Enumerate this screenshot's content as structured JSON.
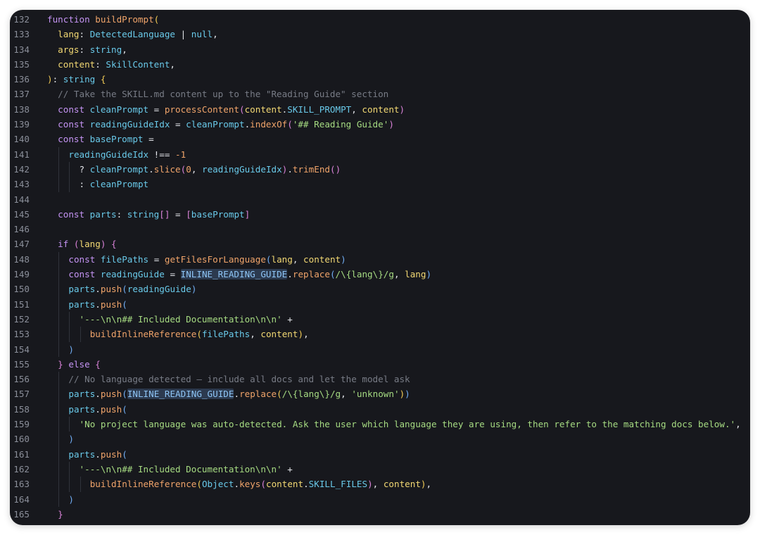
{
  "editor": {
    "lines": [
      {
        "num": "132",
        "indent": 0,
        "tokens": [
          {
            "t": "function ",
            "c": "kw"
          },
          {
            "t": "buildPrompt",
            "c": "fn"
          },
          {
            "t": "(",
            "c": "br1"
          }
        ]
      },
      {
        "num": "133",
        "indent": 1,
        "tokens": [
          {
            "t": "lang",
            "c": "pr"
          },
          {
            "t": ": ",
            "c": "pl"
          },
          {
            "t": "DetectedLanguage",
            "c": "ty"
          },
          {
            "t": " | ",
            "c": "pl"
          },
          {
            "t": "null",
            "c": "ty"
          },
          {
            "t": ",",
            "c": "pl"
          }
        ]
      },
      {
        "num": "134",
        "indent": 1,
        "tokens": [
          {
            "t": "args",
            "c": "pr"
          },
          {
            "t": ": ",
            "c": "pl"
          },
          {
            "t": "string",
            "c": "ty"
          },
          {
            "t": ",",
            "c": "pl"
          }
        ]
      },
      {
        "num": "135",
        "indent": 1,
        "tokens": [
          {
            "t": "content",
            "c": "pr"
          },
          {
            "t": ": ",
            "c": "pl"
          },
          {
            "t": "SkillContent",
            "c": "ty"
          },
          {
            "t": ",",
            "c": "pl"
          }
        ]
      },
      {
        "num": "136",
        "indent": 0,
        "tokens": [
          {
            "t": ")",
            "c": "br1"
          },
          {
            "t": ": ",
            "c": "pl"
          },
          {
            "t": "string",
            "c": "ty"
          },
          {
            "t": " ",
            "c": "pl"
          },
          {
            "t": "{",
            "c": "br1"
          }
        ]
      },
      {
        "num": "137",
        "indent": 1,
        "tokens": [
          {
            "t": "// Take the SKILL.md content up to the \"Reading Guide\" section",
            "c": "cmt"
          }
        ]
      },
      {
        "num": "138",
        "indent": 1,
        "tokens": [
          {
            "t": "const ",
            "c": "kw"
          },
          {
            "t": "cleanPrompt",
            "c": "ty"
          },
          {
            "t": " = ",
            "c": "pl"
          },
          {
            "t": "processContent",
            "c": "fn"
          },
          {
            "t": "(",
            "c": "br2"
          },
          {
            "t": "content",
            "c": "pr"
          },
          {
            "t": ".",
            "c": "pl"
          },
          {
            "t": "SKILL_PROMPT",
            "c": "ty"
          },
          {
            "t": ", ",
            "c": "pl"
          },
          {
            "t": "content",
            "c": "pr"
          },
          {
            "t": ")",
            "c": "br2"
          }
        ]
      },
      {
        "num": "139",
        "indent": 1,
        "tokens": [
          {
            "t": "const ",
            "c": "kw"
          },
          {
            "t": "readingGuideIdx",
            "c": "ty"
          },
          {
            "t": " = ",
            "c": "pl"
          },
          {
            "t": "cleanPrompt",
            "c": "ty"
          },
          {
            "t": ".",
            "c": "pl"
          },
          {
            "t": "indexOf",
            "c": "fn"
          },
          {
            "t": "(",
            "c": "br2"
          },
          {
            "t": "'## Reading Guide'",
            "c": "str"
          },
          {
            "t": ")",
            "c": "br2"
          }
        ]
      },
      {
        "num": "140",
        "indent": 1,
        "tokens": [
          {
            "t": "const ",
            "c": "kw"
          },
          {
            "t": "basePrompt",
            "c": "ty"
          },
          {
            "t": " =",
            "c": "pl"
          }
        ]
      },
      {
        "num": "141",
        "indent": 2,
        "tokens": [
          {
            "t": "readingGuideIdx",
            "c": "ty"
          },
          {
            "t": " !== ",
            "c": "pl"
          },
          {
            "t": "-1",
            "c": "num"
          }
        ]
      },
      {
        "num": "142",
        "indent": 3,
        "tokens": [
          {
            "t": "? ",
            "c": "pl"
          },
          {
            "t": "cleanPrompt",
            "c": "ty"
          },
          {
            "t": ".",
            "c": "pl"
          },
          {
            "t": "slice",
            "c": "fn"
          },
          {
            "t": "(",
            "c": "br2"
          },
          {
            "t": "0",
            "c": "num"
          },
          {
            "t": ", ",
            "c": "pl"
          },
          {
            "t": "readingGuideIdx",
            "c": "ty"
          },
          {
            "t": ")",
            "c": "br2"
          },
          {
            "t": ".",
            "c": "pl"
          },
          {
            "t": "trimEnd",
            "c": "fn"
          },
          {
            "t": "()",
            "c": "br2"
          }
        ]
      },
      {
        "num": "143",
        "indent": 3,
        "tokens": [
          {
            "t": ": ",
            "c": "pl"
          },
          {
            "t": "cleanPrompt",
            "c": "ty"
          }
        ]
      },
      {
        "num": "144",
        "indent": 1,
        "tokens": []
      },
      {
        "num": "145",
        "indent": 1,
        "tokens": [
          {
            "t": "const ",
            "c": "kw"
          },
          {
            "t": "parts",
            "c": "ty"
          },
          {
            "t": ": ",
            "c": "pl"
          },
          {
            "t": "string",
            "c": "ty"
          },
          {
            "t": "[]",
            "c": "br2"
          },
          {
            "t": " = ",
            "c": "pl"
          },
          {
            "t": "[",
            "c": "br2"
          },
          {
            "t": "basePrompt",
            "c": "ty"
          },
          {
            "t": "]",
            "c": "br2"
          }
        ]
      },
      {
        "num": "146",
        "indent": 1,
        "tokens": []
      },
      {
        "num": "147",
        "indent": 1,
        "tokens": [
          {
            "t": "if ",
            "c": "kw"
          },
          {
            "t": "(",
            "c": "br2"
          },
          {
            "t": "lang",
            "c": "pr"
          },
          {
            "t": ")",
            "c": "br2"
          },
          {
            "t": " ",
            "c": "pl"
          },
          {
            "t": "{",
            "c": "br2"
          }
        ]
      },
      {
        "num": "148",
        "indent": 2,
        "tokens": [
          {
            "t": "const ",
            "c": "kw"
          },
          {
            "t": "filePaths",
            "c": "ty"
          },
          {
            "t": " = ",
            "c": "pl"
          },
          {
            "t": "getFilesForLanguage",
            "c": "fn"
          },
          {
            "t": "(",
            "c": "br3"
          },
          {
            "t": "lang",
            "c": "pr"
          },
          {
            "t": ", ",
            "c": "pl"
          },
          {
            "t": "content",
            "c": "pr"
          },
          {
            "t": ")",
            "c": "br3"
          }
        ]
      },
      {
        "num": "149",
        "indent": 2,
        "tokens": [
          {
            "t": "const ",
            "c": "kw"
          },
          {
            "t": "readingGuide",
            "c": "ty"
          },
          {
            "t": " = ",
            "c": "pl"
          },
          {
            "t": "INLINE_READING_GUIDE",
            "c": "hl"
          },
          {
            "t": ".",
            "c": "pl"
          },
          {
            "t": "replace",
            "c": "fn"
          },
          {
            "t": "(",
            "c": "br3"
          },
          {
            "t": "/\\{lang\\}/g",
            "c": "str"
          },
          {
            "t": ", ",
            "c": "pl"
          },
          {
            "t": "lang",
            "c": "pr"
          },
          {
            "t": ")",
            "c": "br3"
          }
        ]
      },
      {
        "num": "150",
        "indent": 2,
        "tokens": [
          {
            "t": "parts",
            "c": "ty"
          },
          {
            "t": ".",
            "c": "pl"
          },
          {
            "t": "push",
            "c": "fn"
          },
          {
            "t": "(",
            "c": "br3"
          },
          {
            "t": "readingGuide",
            "c": "ty"
          },
          {
            "t": ")",
            "c": "br3"
          }
        ]
      },
      {
        "num": "151",
        "indent": 2,
        "tokens": [
          {
            "t": "parts",
            "c": "ty"
          },
          {
            "t": ".",
            "c": "pl"
          },
          {
            "t": "push",
            "c": "fn"
          },
          {
            "t": "(",
            "c": "br3"
          }
        ]
      },
      {
        "num": "152",
        "indent": 3,
        "tokens": [
          {
            "t": "'---\\n\\n## Included Documentation\\n\\n'",
            "c": "str"
          },
          {
            "t": " +",
            "c": "pl"
          }
        ]
      },
      {
        "num": "153",
        "indent": 4,
        "tokens": [
          {
            "t": "buildInlineReference",
            "c": "fn"
          },
          {
            "t": "(",
            "c": "br1"
          },
          {
            "t": "filePaths",
            "c": "ty"
          },
          {
            "t": ", ",
            "c": "pl"
          },
          {
            "t": "content",
            "c": "pr"
          },
          {
            "t": ")",
            "c": "br1"
          },
          {
            "t": ",",
            "c": "pl"
          }
        ]
      },
      {
        "num": "154",
        "indent": 2,
        "tokens": [
          {
            "t": ")",
            "c": "br3"
          }
        ]
      },
      {
        "num": "155",
        "indent": 1,
        "tokens": [
          {
            "t": "}",
            "c": "br2"
          },
          {
            "t": " else ",
            "c": "kw"
          },
          {
            "t": "{",
            "c": "br2"
          }
        ]
      },
      {
        "num": "156",
        "indent": 2,
        "tokens": [
          {
            "t": "// No language detected — include all docs and let the model ask",
            "c": "cmt"
          }
        ]
      },
      {
        "num": "157",
        "indent": 2,
        "tokens": [
          {
            "t": "parts",
            "c": "ty"
          },
          {
            "t": ".",
            "c": "pl"
          },
          {
            "t": "push",
            "c": "fn"
          },
          {
            "t": "(",
            "c": "br3"
          },
          {
            "t": "INLINE_READING_GUIDE",
            "c": "hl"
          },
          {
            "t": ".",
            "c": "pl"
          },
          {
            "t": "replace",
            "c": "fn"
          },
          {
            "t": "(",
            "c": "br1"
          },
          {
            "t": "/\\{lang\\}/g",
            "c": "str"
          },
          {
            "t": ", ",
            "c": "pl"
          },
          {
            "t": "'unknown'",
            "c": "str"
          },
          {
            "t": ")",
            "c": "br1"
          },
          {
            "t": ")",
            "c": "br3"
          }
        ]
      },
      {
        "num": "158",
        "indent": 2,
        "tokens": [
          {
            "t": "parts",
            "c": "ty"
          },
          {
            "t": ".",
            "c": "pl"
          },
          {
            "t": "push",
            "c": "fn"
          },
          {
            "t": "(",
            "c": "br3"
          }
        ]
      },
      {
        "num": "159",
        "indent": 3,
        "tokens": [
          {
            "t": "'No project language was auto-detected. Ask the user which language they are using, then refer to the matching docs below.'",
            "c": "str"
          },
          {
            "t": ",",
            "c": "pl"
          }
        ]
      },
      {
        "num": "160",
        "indent": 2,
        "tokens": [
          {
            "t": ")",
            "c": "br3"
          }
        ]
      },
      {
        "num": "161",
        "indent": 2,
        "tokens": [
          {
            "t": "parts",
            "c": "ty"
          },
          {
            "t": ".",
            "c": "pl"
          },
          {
            "t": "push",
            "c": "fn"
          },
          {
            "t": "(",
            "c": "br3"
          }
        ]
      },
      {
        "num": "162",
        "indent": 3,
        "tokens": [
          {
            "t": "'---\\n\\n## Included Documentation\\n\\n'",
            "c": "str"
          },
          {
            "t": " +",
            "c": "pl"
          }
        ]
      },
      {
        "num": "163",
        "indent": 4,
        "tokens": [
          {
            "t": "buildInlineReference",
            "c": "fn"
          },
          {
            "t": "(",
            "c": "br1"
          },
          {
            "t": "Object",
            "c": "ty"
          },
          {
            "t": ".",
            "c": "pl"
          },
          {
            "t": "keys",
            "c": "fn"
          },
          {
            "t": "(",
            "c": "br2"
          },
          {
            "t": "content",
            "c": "pr"
          },
          {
            "t": ".",
            "c": "pl"
          },
          {
            "t": "SKILL_FILES",
            "c": "ty"
          },
          {
            "t": ")",
            "c": "br2"
          },
          {
            "t": ", ",
            "c": "pl"
          },
          {
            "t": "content",
            "c": "pr"
          },
          {
            "t": ")",
            "c": "br1"
          },
          {
            "t": ",",
            "c": "pl"
          }
        ]
      },
      {
        "num": "164",
        "indent": 2,
        "tokens": [
          {
            "t": ")",
            "c": "br3"
          }
        ]
      },
      {
        "num": "165",
        "indent": 1,
        "tokens": [
          {
            "t": "}",
            "c": "br2"
          }
        ]
      }
    ]
  }
}
